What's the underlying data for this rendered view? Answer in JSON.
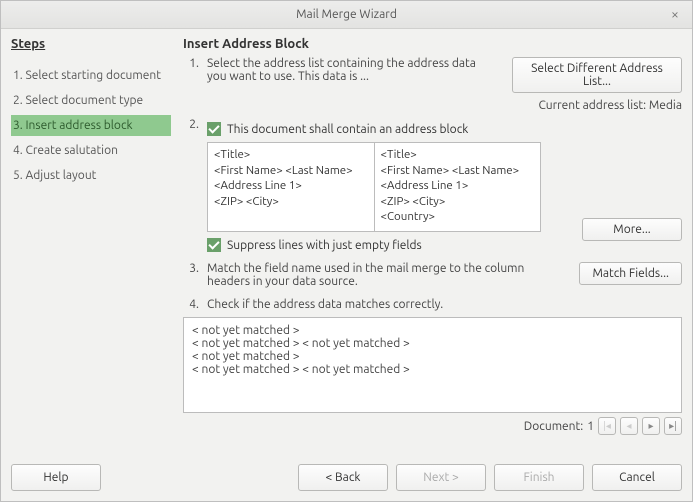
{
  "window": {
    "title": "Mail Merge Wizard"
  },
  "sidebar": {
    "header": "Steps",
    "items": [
      {
        "label": "1. Select starting document"
      },
      {
        "label": "2. Select document type"
      },
      {
        "label": "3. Insert address block"
      },
      {
        "label": "4. Create salutation"
      },
      {
        "label": "5. Adjust layout"
      }
    ],
    "active_index": 2
  },
  "main": {
    "header": "Insert Address Block",
    "step1": {
      "num": "1.",
      "text": "Select the address list containing the address data you want to use. This data is ...",
      "button": "Select Different Address List...",
      "current": "Current address list: Media"
    },
    "step2": {
      "num": "2.",
      "checkbox": "This document shall contain an address block",
      "left_lines": [
        "<Title>",
        "<First Name> <Last Name>",
        "<Address Line 1>",
        "<ZIP> <City>"
      ],
      "right_lines": [
        "<Title>",
        "<First Name> <Last Name>",
        "<Address Line 1>",
        "<ZIP> <City>",
        "<Country>"
      ],
      "more_button": "More...",
      "suppress": "Suppress lines with just empty fields"
    },
    "step3": {
      "num": "3.",
      "text": "Match the field name used in the mail merge to the column headers in your data source.",
      "button": "Match Fields..."
    },
    "step4": {
      "num": "4.",
      "text": "Check if the address data matches correctly.",
      "preview_lines": [
        "< not yet matched >",
        "< not yet matched > < not yet matched >",
        "< not yet matched >",
        "< not yet matched > < not yet matched >"
      ],
      "doc_label": "Document:",
      "doc_value": "1"
    }
  },
  "footer": {
    "help": "Help",
    "back": "< Back",
    "next": "Next >",
    "finish": "Finish",
    "cancel": "Cancel"
  }
}
